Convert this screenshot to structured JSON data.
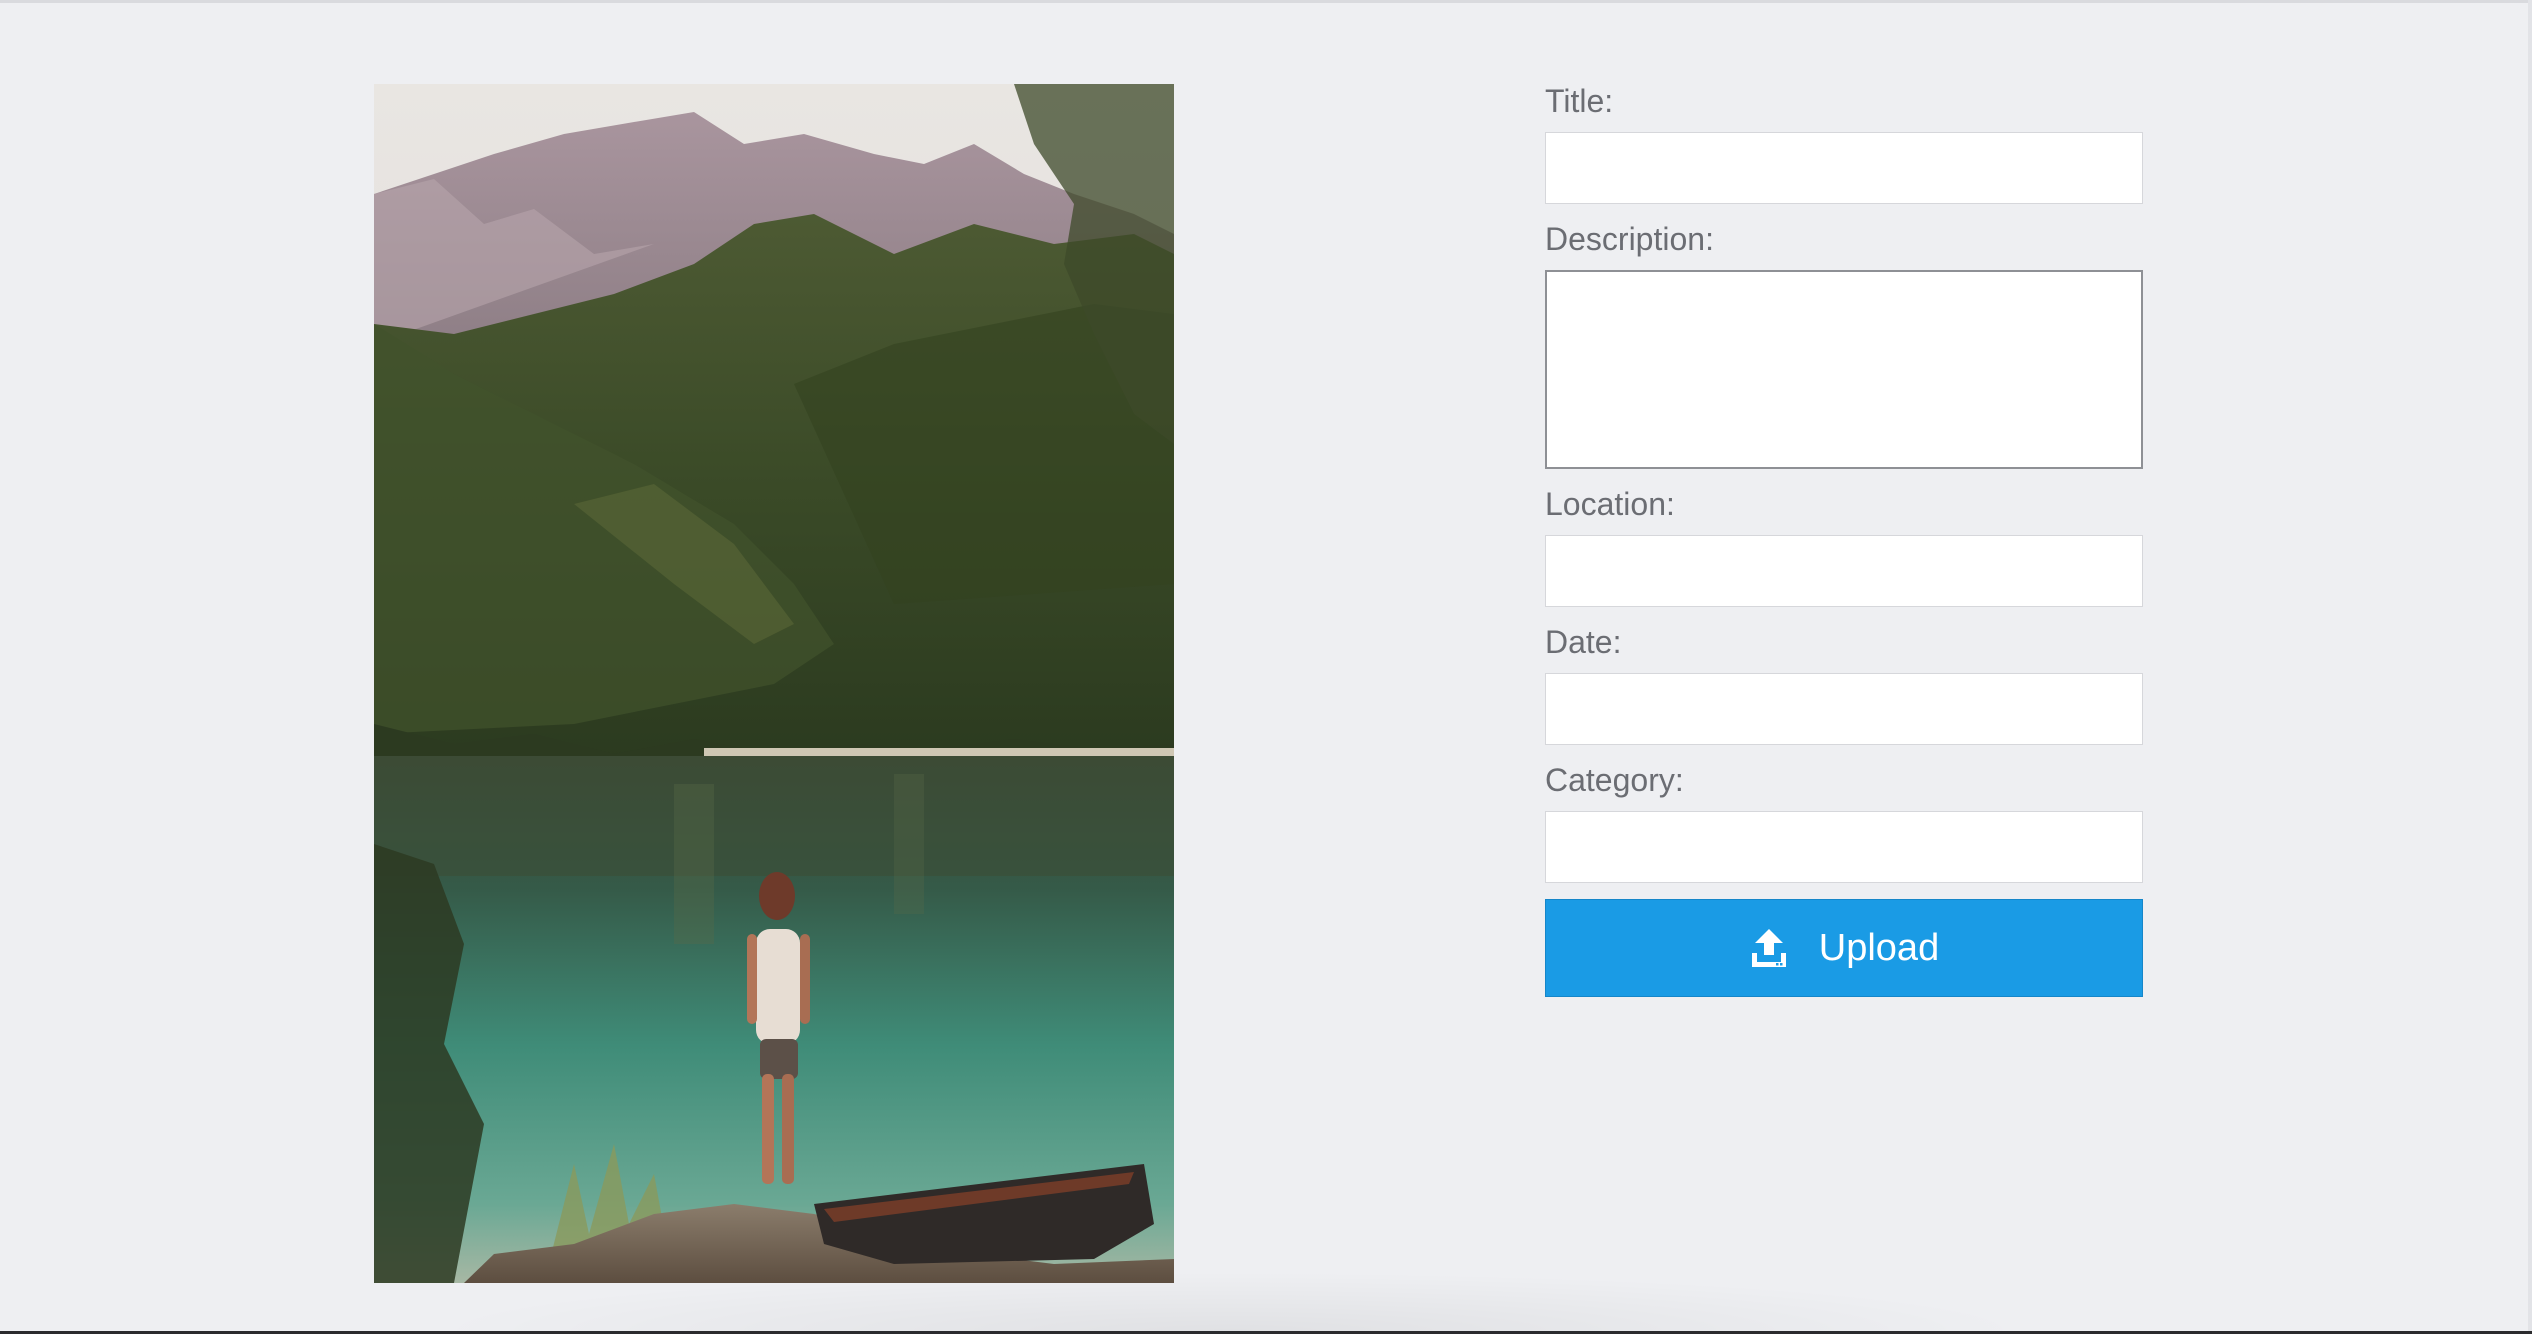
{
  "form": {
    "title_label": "Title:",
    "title_value": "",
    "description_label": "Description:",
    "description_value": "",
    "location_label": "Location:",
    "location_value": "",
    "date_label": "Date:",
    "date_value": "",
    "category_label": "Category:",
    "category_value": "",
    "upload_label": "Upload",
    "upload_icon": "upload-icon"
  },
  "colors": {
    "background": "#eeeff2",
    "accent": "#1a9be5",
    "label_text": "#6b6d73"
  }
}
